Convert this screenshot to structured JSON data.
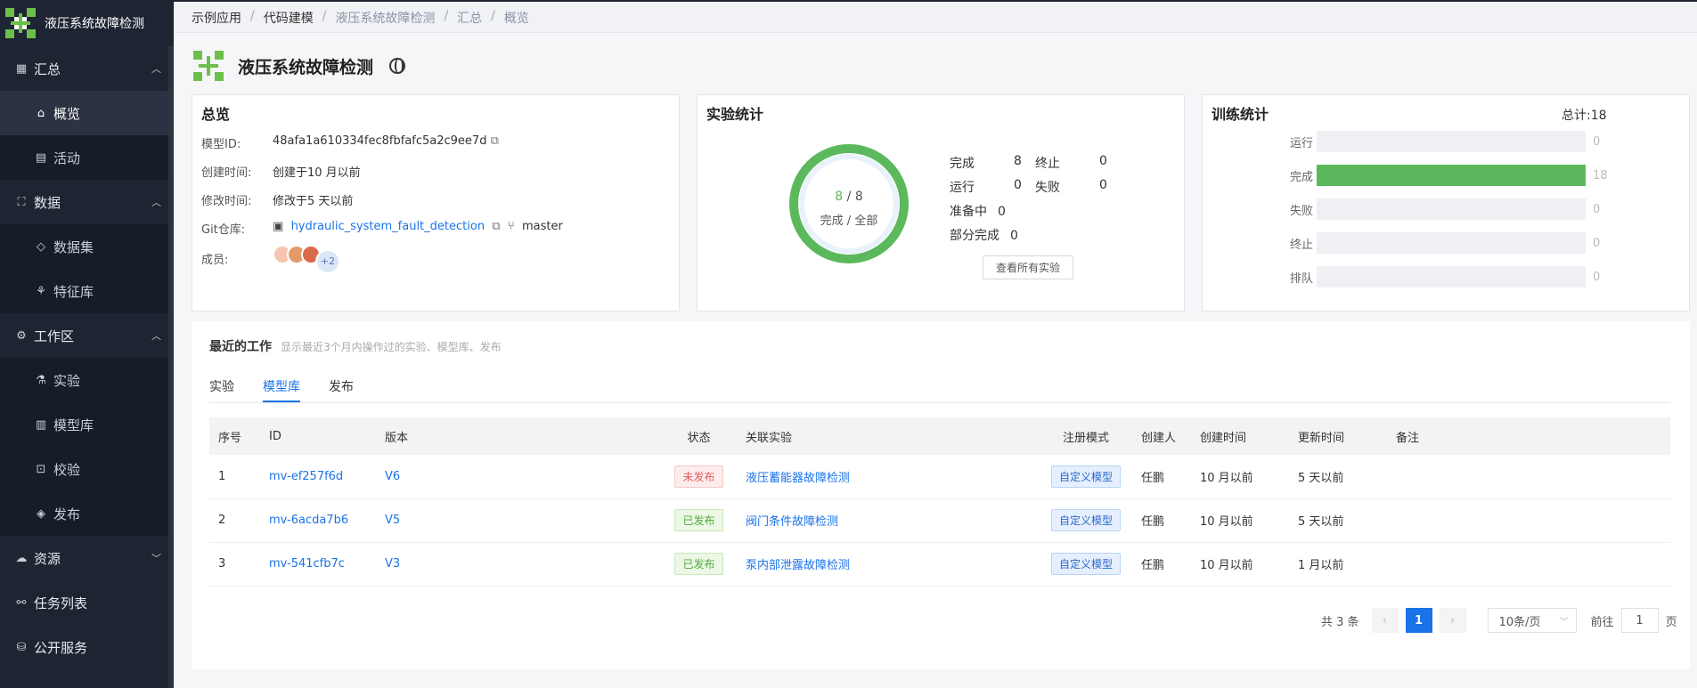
{
  "sidebar": {
    "app_name": "液压系统故障检测",
    "groups": [
      {
        "label": "汇总",
        "icon": "dashboard-icon",
        "items": [
          "概览",
          "活动"
        ]
      },
      {
        "label": "数据",
        "icon": "data-icon",
        "items": [
          "数据集",
          "特征库"
        ]
      },
      {
        "label": "工作区",
        "icon": "workspace-icon",
        "items": [
          "实验",
          "模型库",
          "校验",
          "发布"
        ]
      },
      {
        "label": "资源",
        "icon": "resource-icon",
        "items": []
      },
      {
        "label": "任务列表",
        "icon": "task-icon",
        "items": []
      },
      {
        "label": "公开服务",
        "icon": "service-icon",
        "items": []
      }
    ]
  },
  "breadcrumb": [
    "示例应用",
    "代码建模",
    "液压系统故障检测",
    "汇总",
    "概览"
  ],
  "page_title": "液压系统故障检测",
  "overview": {
    "title": "总览",
    "model_id_label": "模型ID:",
    "model_id": "48afa1a610334fec8fbfafc5a2c9ee7d",
    "created_label": "创建时间:",
    "created": "创建于10 月以前",
    "modified_label": "修改时间:",
    "modified": "修改于5 天以前",
    "git_label": "Git仓库:",
    "git_repo": "hydraulic_system_fault_detection",
    "git_branch": "master",
    "members_label": "成员:",
    "members_more": "+2"
  },
  "experiments": {
    "title": "实验统计",
    "center_done": "8",
    "center_total": "8",
    "center_caption": "完成 / 全部",
    "stats": [
      {
        "label": "完成",
        "value": "8"
      },
      {
        "label": "终止",
        "value": "0"
      },
      {
        "label": "运行",
        "value": "0"
      },
      {
        "label": "失败",
        "value": "0"
      },
      {
        "label": "准备中",
        "value": "0"
      },
      {
        "label": "部分完成",
        "value": "0"
      }
    ],
    "view_all": "查看所有实验"
  },
  "training": {
    "title": "训练统计",
    "total": "总计:18",
    "max": 18,
    "bars": [
      {
        "label": "运行",
        "value": 0
      },
      {
        "label": "完成",
        "value": 18
      },
      {
        "label": "失败",
        "value": 0
      },
      {
        "label": "终止",
        "value": 0
      },
      {
        "label": "排队",
        "value": 0
      }
    ]
  },
  "recent": {
    "title": "最近的工作",
    "subtitle": "显示最近3个月内操作过的实验、模型库、发布",
    "tabs": [
      "实验",
      "模型库",
      "发布"
    ],
    "active_tab": 1,
    "columns": [
      "序号",
      "ID",
      "版本",
      "状态",
      "关联实验",
      "注册模式",
      "创建人",
      "创建时间",
      "更新时间",
      "备注"
    ],
    "rows": [
      {
        "no": "1",
        "id": "mv-ef257f6d",
        "version": "V6",
        "status": "未发布",
        "status_type": "red",
        "experiment": "液压蓄能器故障检测",
        "mode": "自定义模型",
        "creator": "任鹏",
        "created": "10 月以前",
        "updated": "5 天以前",
        "note": ""
      },
      {
        "no": "2",
        "id": "mv-6acda7b6",
        "version": "V5",
        "status": "已发布",
        "status_type": "green",
        "experiment": "阀门条件故障检测",
        "mode": "自定义模型",
        "creator": "任鹏",
        "created": "10 月以前",
        "updated": "5 天以前",
        "note": ""
      },
      {
        "no": "3",
        "id": "mv-541cfb7c",
        "version": "V3",
        "status": "已发布",
        "status_type": "green",
        "experiment": "泵内部泄露故障检测",
        "mode": "自定义模型",
        "creator": "任鹏",
        "created": "10 月以前",
        "updated": "1 月以前",
        "note": ""
      }
    ]
  },
  "pagination": {
    "total": "共 3 条",
    "current": "1",
    "page_size": "10条/页",
    "goto_label": "前往",
    "goto_value": "1",
    "page_suffix": "页"
  }
}
